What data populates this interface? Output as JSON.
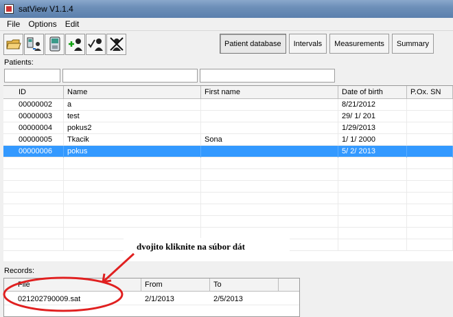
{
  "window": {
    "title": "satView V1.1.4"
  },
  "menu": [
    "File",
    "Options",
    "Edit"
  ],
  "toolbar": {
    "icons": [
      "open-folder-icon",
      "transfer-device-icon",
      "oximeter-device-icon",
      "add-patient-icon",
      "confirm-patient-icon",
      "delete-patient-icon"
    ]
  },
  "tabs": [
    "Patient database",
    "Intervals",
    "Measurements",
    "Summary"
  ],
  "patients": {
    "label": "Patients:",
    "columns": [
      "ID",
      "Name",
      "First name",
      "Date of birth",
      "P.Ox. SN"
    ],
    "rows": [
      [
        "00000002",
        "a",
        "",
        "8/21/2012",
        ""
      ],
      [
        "00000003",
        "test",
        "",
        "29/ 1/ 201",
        ""
      ],
      [
        "00000004",
        "pokus2",
        "",
        "1/29/2013",
        ""
      ],
      [
        "00000005",
        "Tkacik",
        "Sona",
        "1/ 1/ 2000",
        ""
      ],
      [
        "00000006",
        "pokus",
        "",
        "5/ 2/ 2013",
        ""
      ]
    ],
    "selected_index": 4
  },
  "annotation": "dvojito kliknite na súbor dát",
  "records": {
    "label": "Records:",
    "columns": [
      "File",
      "From",
      "To"
    ],
    "rows": [
      [
        "021202790009.sat",
        "2/1/2013",
        "2/5/2013"
      ]
    ]
  },
  "colors": {
    "selection": "#3399ff",
    "annotation_marker": "#e02020"
  }
}
